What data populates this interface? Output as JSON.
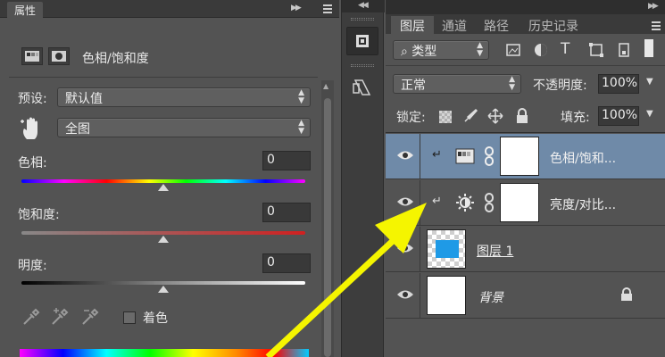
{
  "properties": {
    "tab_label": "属性",
    "title": "色相/饱和度",
    "preset_label": "预设:",
    "preset_value": "默认值",
    "range_value": "全图",
    "hue_label": "色相:",
    "hue_value": "0",
    "saturation_label": "饱和度:",
    "saturation_value": "0",
    "lightness_label": "明度:",
    "lightness_value": "0",
    "colorize_label": "着色",
    "hue_slider": 0,
    "saturation_slider": 0,
    "lightness_slider": 0
  },
  "layers_panel": {
    "tabs": [
      "图层",
      "通道",
      "路径",
      "历史记录"
    ],
    "filter_kind": "类型",
    "blend_mode": "正常",
    "opacity_label": "不透明度:",
    "opacity_value": "100%",
    "lock_label": "锁定:",
    "fill_label": "填充:",
    "fill_value": "100%",
    "layers": [
      {
        "name": "色相/饱和...",
        "type": "hue-saturation-adjustment",
        "selected": true
      },
      {
        "name": "亮度/对比...",
        "type": "brightness-contrast-adjustment",
        "selected": false
      },
      {
        "name": "图层 1",
        "type": "pixel",
        "selected": false
      },
      {
        "name": "背景",
        "type": "background",
        "selected": false
      }
    ]
  },
  "colors": {
    "panel_bg": "#535353",
    "selected_row": "#6f8aa8",
    "annotation_arrow": "#f5f500",
    "layer1_fill": "#1f9ae6"
  }
}
